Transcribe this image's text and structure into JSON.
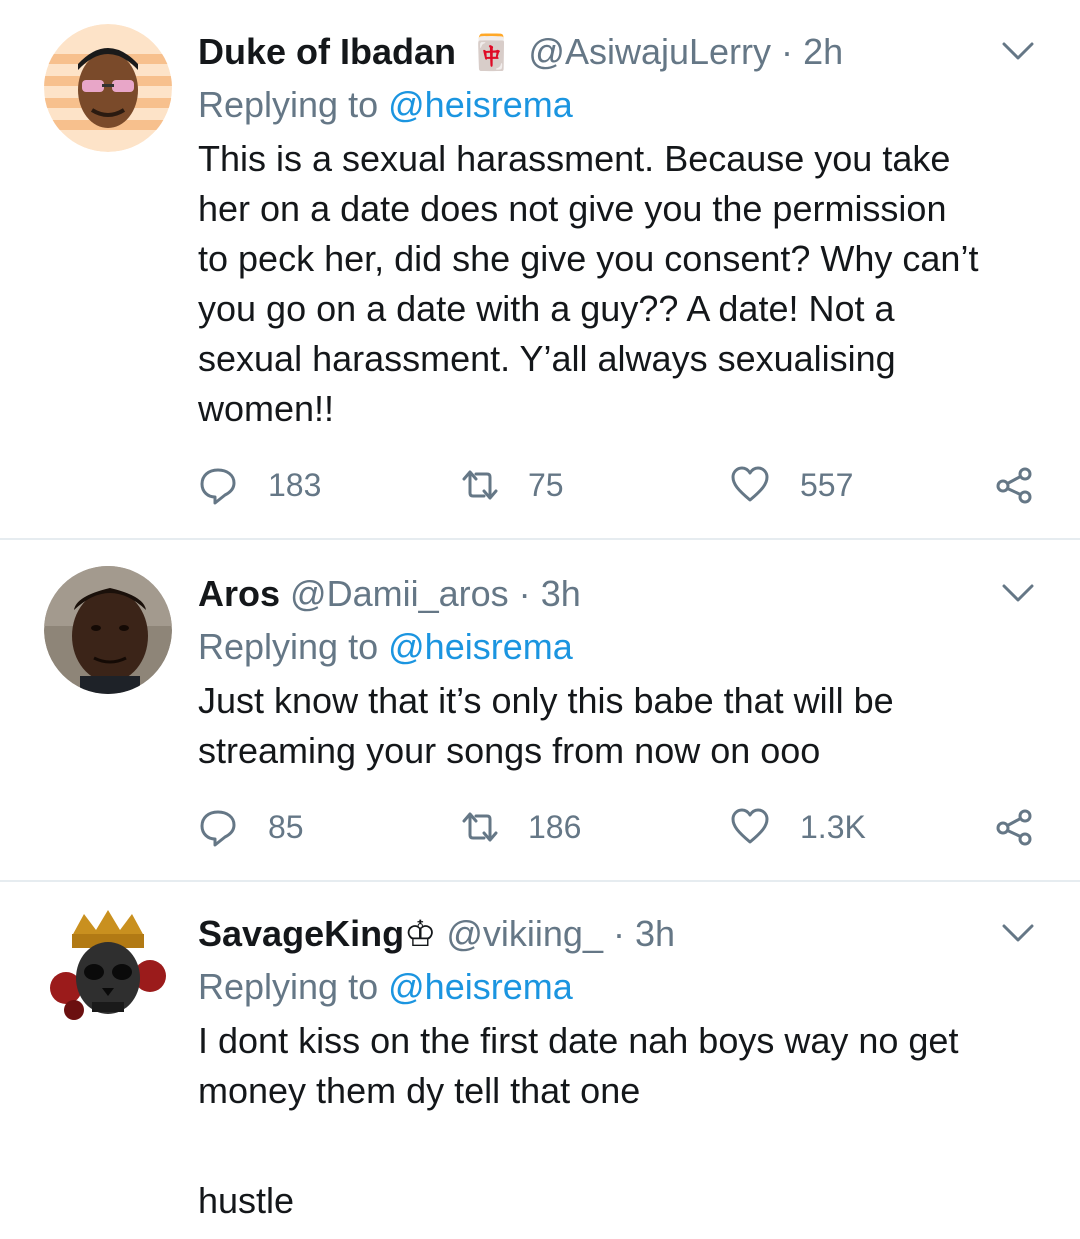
{
  "tweets": [
    {
      "name": "Duke of Ibadan",
      "badge": "🀄",
      "handle": "@AsiwajuLerry",
      "separator": "·",
      "time": "2h",
      "replying_prefix": "Replying to",
      "replying_to": "@heisrema",
      "text_lines": [
        "This is a sexual harassment. Because you take",
        "her on a date does not give you the permission",
        "to peck her, did she give you consent? Why can’t",
        "you go on a date with a guy?? A date! Not a",
        "sexual harassment. Y’all always sexualising",
        "women!!"
      ],
      "replies": "183",
      "retweets": "75",
      "likes": "557"
    },
    {
      "name": "Aros",
      "badge": "",
      "handle": "@Damii_aros",
      "separator": "·",
      "time": "3h",
      "replying_prefix": "Replying to",
      "replying_to": "@heisrema",
      "text_lines": [
        "Just know that it’s only this babe that will be",
        "streaming your songs from now on ooo"
      ],
      "replies": "85",
      "retweets": "186",
      "likes": "1.3K"
    },
    {
      "name": "SavageKing♔",
      "badge": "",
      "handle": "@vikiing_",
      "separator": "·",
      "time": "3h",
      "replying_prefix": "Replying to",
      "replying_to": "@heisrema",
      "text_lines": [
        "I dont kiss on the first date nah boys way no get",
        "money them dy tell that one",
        "",
        "hustle"
      ]
    }
  ],
  "icons": {
    "reply": "comment-bubble-icon",
    "retweet": "retweet-icon",
    "like": "heart-icon",
    "share": "share-icon",
    "menu": "chevron-down-icon"
  },
  "colors": {
    "text": "#14171a",
    "secondary": "#657786",
    "mention": "#1b95e0",
    "divider": "#e6ecf0"
  }
}
